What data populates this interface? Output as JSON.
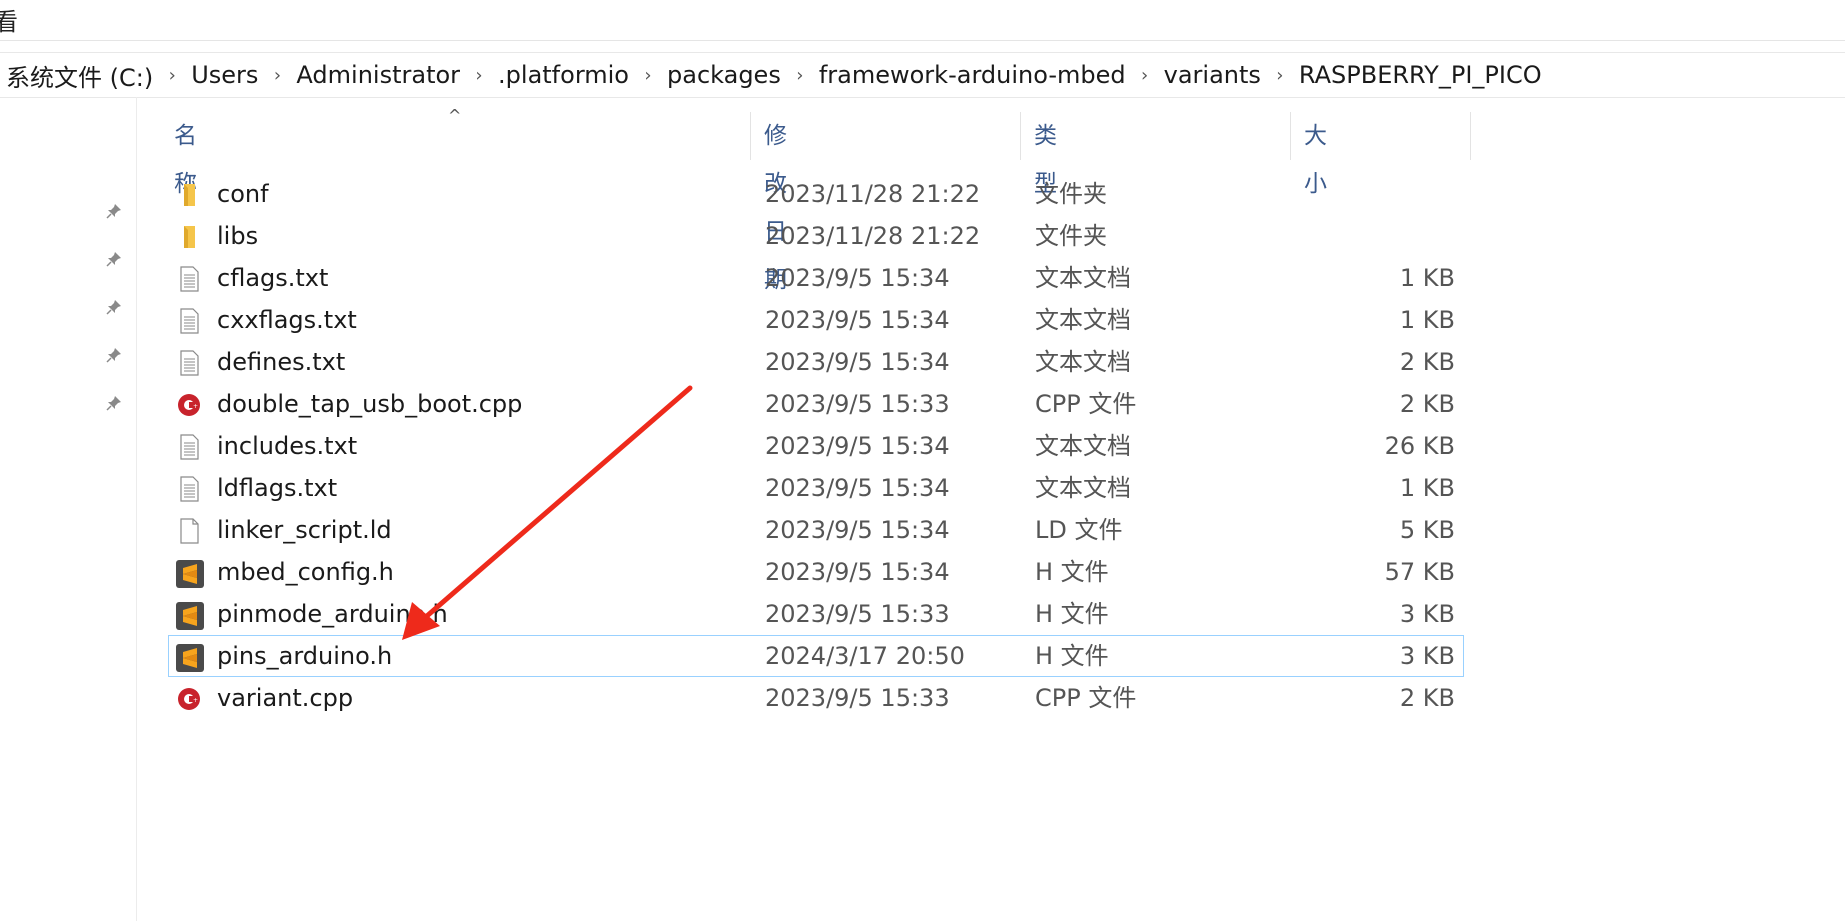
{
  "toolbar": {
    "view_label": "看"
  },
  "breadcrumb": [
    "系统文件 (C:)",
    "Users",
    "Administrator",
    ".platformio",
    "packages",
    "framework-arduino-mbed",
    "variants",
    "RASPBERRY_PI_PICO"
  ],
  "columns": {
    "name": "名称",
    "date": "修改日期",
    "type": "类型",
    "size": "大小"
  },
  "files": [
    {
      "name": "conf",
      "date": "2023/11/28 21:22",
      "type": "文件夹",
      "size": "",
      "icon": "folder-icon"
    },
    {
      "name": "libs",
      "date": "2023/11/28 21:22",
      "type": "文件夹",
      "size": "",
      "icon": "folder-icon"
    },
    {
      "name": "cflags.txt",
      "date": "2023/9/5 15:34",
      "type": "文本文档",
      "size": "1 KB",
      "icon": "text-file-icon"
    },
    {
      "name": "cxxflags.txt",
      "date": "2023/9/5 15:34",
      "type": "文本文档",
      "size": "1 KB",
      "icon": "text-file-icon"
    },
    {
      "name": "defines.txt",
      "date": "2023/9/5 15:34",
      "type": "文本文档",
      "size": "2 KB",
      "icon": "text-file-icon"
    },
    {
      "name": "double_tap_usb_boot.cpp",
      "date": "2023/9/5 15:33",
      "type": "CPP 文件",
      "size": "2 KB",
      "icon": "cpp-file-icon"
    },
    {
      "name": "includes.txt",
      "date": "2023/9/5 15:34",
      "type": "文本文档",
      "size": "26 KB",
      "icon": "text-file-icon"
    },
    {
      "name": "ldflags.txt",
      "date": "2023/9/5 15:34",
      "type": "文本文档",
      "size": "1 KB",
      "icon": "text-file-icon"
    },
    {
      "name": "linker_script.ld",
      "date": "2023/9/5 15:34",
      "type": "LD 文件",
      "size": "5 KB",
      "icon": "blank-file-icon"
    },
    {
      "name": "mbed_config.h",
      "date": "2023/9/5 15:34",
      "type": "H 文件",
      "size": "57 KB",
      "icon": "sublime-file-icon"
    },
    {
      "name": "pinmode_arduino.h",
      "date": "2023/9/5 15:33",
      "type": "H 文件",
      "size": "3 KB",
      "icon": "sublime-file-icon"
    },
    {
      "name": "pins_arduino.h",
      "date": "2024/3/17 20:50",
      "type": "H 文件",
      "size": "3 KB",
      "icon": "sublime-file-icon",
      "selected": true
    },
    {
      "name": "variant.cpp",
      "date": "2023/9/5 15:33",
      "type": "CPP 文件",
      "size": "2 KB",
      "icon": "cpp-file-icon"
    }
  ],
  "colors": {
    "arrow": "#ee2a1b",
    "header_text": "#3b5a8c",
    "selection_border": "#99d1ff",
    "folder": "#f5c54a",
    "sublime": "#4a4a4a",
    "cpp": "#c8232c"
  }
}
